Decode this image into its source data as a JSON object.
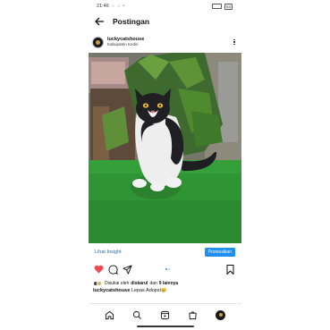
{
  "status_bar": {
    "time": "21:46",
    "battery": "54"
  },
  "header": {
    "title": "Postingan"
  },
  "post": {
    "username": "luckycatshouse",
    "location": "Kabupaten Kediri",
    "image_alt_icon": "cat-photo"
  },
  "insight": {
    "link_label": "Lihat Insight",
    "promote_label": "Promosikan"
  },
  "likes": {
    "prefix": "Disukai oleh",
    "user": "diskarul",
    "middle": "dan",
    "others": "9 lainnya"
  },
  "caption": {
    "user": "luckycatshouse",
    "text": "Lepas Adopsi😸"
  },
  "colors": {
    "heart": "#ed4956",
    "accent": "#1f8ff0",
    "dot_active": "#1f8ff0",
    "dot_inactive": "#c7c7c7"
  },
  "nav_icons": [
    "home-icon",
    "search-icon",
    "reels-icon",
    "shop-icon",
    "profile-avatar"
  ]
}
